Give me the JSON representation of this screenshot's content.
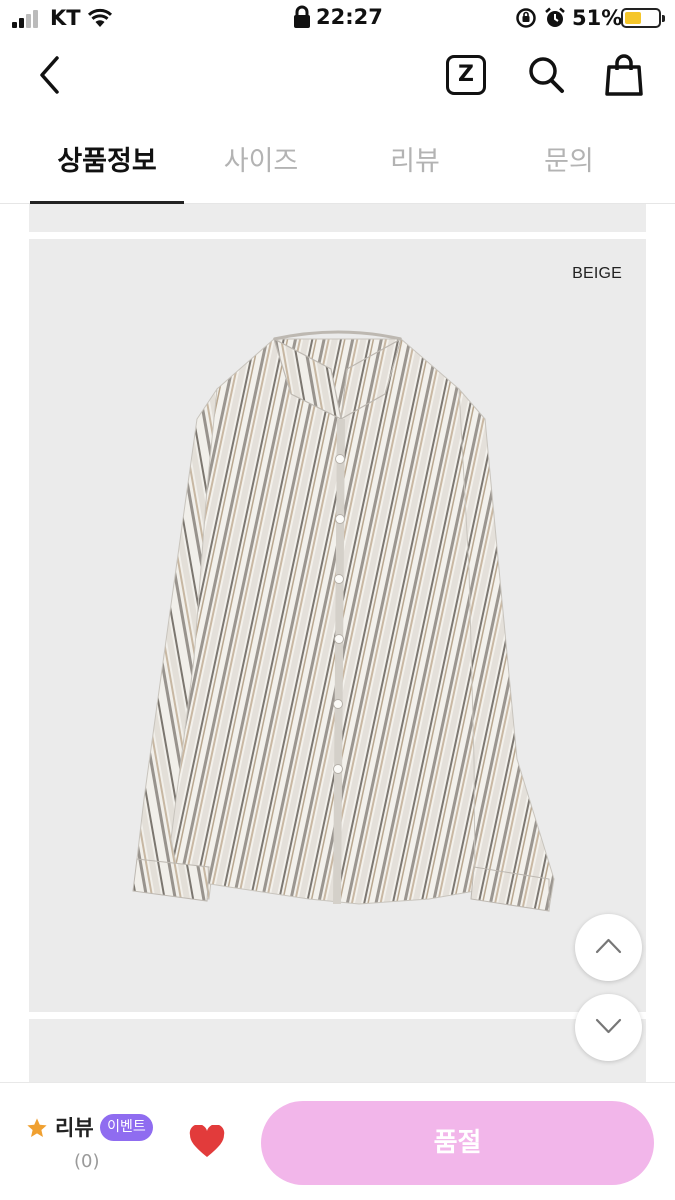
{
  "status_bar": {
    "carrier": "KT",
    "time": "22:27",
    "battery": "51%",
    "battery_level": 0.51
  },
  "header": {
    "icons": [
      "back-icon",
      "zigzag-icon",
      "search-icon",
      "shopping-bag-icon"
    ],
    "z_label": "Z"
  },
  "tabs": [
    {
      "label": "상품정보",
      "active": true
    },
    {
      "label": "사이즈",
      "active": false
    },
    {
      "label": "리뷰",
      "active": false
    },
    {
      "label": "문의",
      "active": false
    }
  ],
  "product": {
    "color_label": "BEIGE"
  },
  "bottom_bar": {
    "review_label": "리뷰",
    "event_badge": "이벤트",
    "review_count": "(0)",
    "soldout_label": "품절"
  },
  "colors": {
    "soldout_button": "#f2b6ea",
    "event_badge": "#8f6cf0",
    "heart": "#e23b3b",
    "star": "#f0a030",
    "battery_fill": "#f5c62a"
  }
}
